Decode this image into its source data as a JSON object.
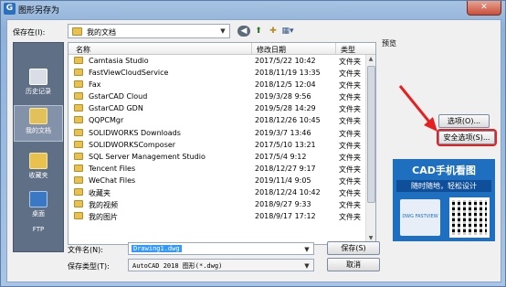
{
  "window": {
    "title": "图形另存为",
    "close": "✕"
  },
  "toolbar": {
    "save_in_label": "保存在(I):",
    "save_in_value": "我的文档"
  },
  "places": [
    {
      "label": "历史记录"
    },
    {
      "label": "我的文档"
    },
    {
      "label": "收藏夹"
    },
    {
      "label": "桌面"
    },
    {
      "label": "FTP"
    }
  ],
  "list": {
    "columns": {
      "name": "名称",
      "date": "修改日期",
      "type": "类型"
    },
    "rows": [
      {
        "name": "Camtasia Studio",
        "date": "2017/5/22 10:42",
        "type": "文件夹"
      },
      {
        "name": "FastViewCloudService",
        "date": "2018/11/19 13:35",
        "type": "文件夹"
      },
      {
        "name": "Fax",
        "date": "2018/12/5 12:04",
        "type": "文件夹"
      },
      {
        "name": "GstarCAD Cloud",
        "date": "2019/3/28 9:56",
        "type": "文件夹"
      },
      {
        "name": "GstarCAD GDN",
        "date": "2019/5/28 14:29",
        "type": "文件夹"
      },
      {
        "name": "QQPCMgr",
        "date": "2018/12/26 10:45",
        "type": "文件夹"
      },
      {
        "name": "SOLIDWORKS Downloads",
        "date": "2019/3/7 13:46",
        "type": "文件夹"
      },
      {
        "name": "SOLIDWORKSComposer",
        "date": "2017/5/10 13:21",
        "type": "文件夹"
      },
      {
        "name": "SQL Server Management Studio",
        "date": "2017/5/4 9:12",
        "type": "文件夹"
      },
      {
        "name": "Tencent Files",
        "date": "2018/12/27 9:17",
        "type": "文件夹"
      },
      {
        "name": "WeChat Files",
        "date": "2019/11/4 9:05",
        "type": "文件夹"
      },
      {
        "name": "收藏夹",
        "date": "2018/12/24 10:42",
        "type": "文件夹"
      },
      {
        "name": "我的视频",
        "date": "2018/9/27 9:33",
        "type": "文件夹"
      },
      {
        "name": "我的图片",
        "date": "2018/9/17 17:12",
        "type": "文件夹"
      }
    ]
  },
  "preview": {
    "label": "预览"
  },
  "buttons": {
    "options": "选项(O)...",
    "security": "安全选项(S)...",
    "save": "保存(S)",
    "cancel": "取消"
  },
  "ad": {
    "title": "CAD手机看图",
    "subtitle": "随时随地，轻松设计",
    "badge": "DWG FASTVIEW"
  },
  "file": {
    "name_label": "文件名(N):",
    "name_value": "Drawing1.dwg",
    "type_label": "保存类型(T):",
    "type_value": "AutoCAD 2018 图形(*.dwg)"
  },
  "colors": {
    "highlight": "#e62020",
    "ad_bg": "#1f6fc0",
    "selection": "#3399ff"
  }
}
